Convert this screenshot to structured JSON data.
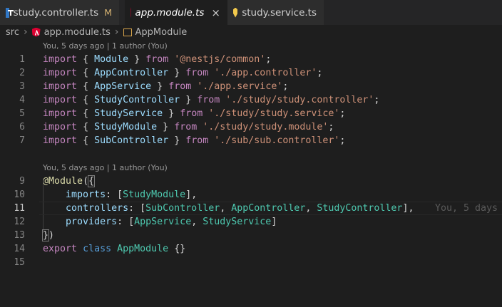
{
  "tabs": [
    {
      "label": "study.controller.ts",
      "status": "M",
      "icon": "typescript-file-icon",
      "active": false
    },
    {
      "label": "app.module.ts",
      "icon": "angular-file-icon",
      "active": true,
      "close": "×"
    },
    {
      "label": "study.service.ts",
      "icon": "angular-service-icon",
      "active": false
    }
  ],
  "breadcrumb": {
    "folder": "src",
    "file": "app.module.ts",
    "symbol": "AppModule"
  },
  "codelens": {
    "top": "You, 5 days ago | 1 author (You)",
    "decorator": "You, 5 days ago | 1 author (You)"
  },
  "ghost_blame": "You, 5 days",
  "line_numbers": [
    "1",
    "2",
    "3",
    "4",
    "5",
    "6",
    "7",
    "9",
    "10",
    "11",
    "12",
    "13",
    "14",
    "15"
  ],
  "current_line": "11",
  "code": {
    "l1": {
      "kw": "import",
      "o": "{",
      "name": "Module",
      "c": "}",
      "from": "from",
      "path": "'@nestjs/common'",
      "end": ";"
    },
    "l2": {
      "kw": "import",
      "o": "{",
      "name": "AppController",
      "c": "}",
      "from": "from",
      "path": "'./app.controller'",
      "end": ";"
    },
    "l3": {
      "kw": "import",
      "o": "{",
      "name": "AppService",
      "c": "}",
      "from": "from",
      "path": "'./app.service'",
      "end": ";"
    },
    "l4": {
      "kw": "import",
      "o": "{",
      "name": "StudyController",
      "c": "}",
      "from": "from",
      "path": "'./study/study.controller'",
      "end": ";"
    },
    "l5": {
      "kw": "import",
      "o": "{",
      "name": "StudyService",
      "c": "}",
      "from": "from",
      "path": "'./study/study.service'",
      "end": ";"
    },
    "l6": {
      "kw": "import",
      "o": "{",
      "name": "StudyModule",
      "c": "}",
      "from": "from",
      "path": "'./study/study.module'",
      "end": ";"
    },
    "l7": {
      "kw": "import",
      "o": "{",
      "name": "SubController",
      "c": "}",
      "from": "from",
      "path": "'./sub/sub.controller'",
      "end": ";"
    },
    "l9": {
      "at": "@",
      "dec": "Module",
      "p": "(",
      "b": "{"
    },
    "l10": {
      "prop": "imports",
      "colon": ":",
      "o": "[",
      "a": "StudyModule",
      "c": "],"
    },
    "l11": {
      "prop": "controllers",
      "colon": ":",
      "o": "[",
      "a": "SubController",
      "s1": ",",
      "b": "AppController",
      "s2": ",",
      "c2": "StudyController",
      "end": "],"
    },
    "l12": {
      "prop": "providers",
      "colon": ":",
      "o": "[",
      "a": "AppService",
      "s1": ",",
      "b": "StudyService",
      "end": "]"
    },
    "l13": {
      "b": "}",
      "p": ")"
    },
    "l14": {
      "kw": "export",
      "cls": "class",
      "name": "AppModule",
      "body": "{}"
    }
  },
  "colors": {
    "keyword": "#c586c0",
    "string": "#ce9178",
    "type": "#4ec9b0",
    "variable": "#9cdcfe",
    "decorator": "#dcdcaa",
    "storage": "#569cd6"
  }
}
